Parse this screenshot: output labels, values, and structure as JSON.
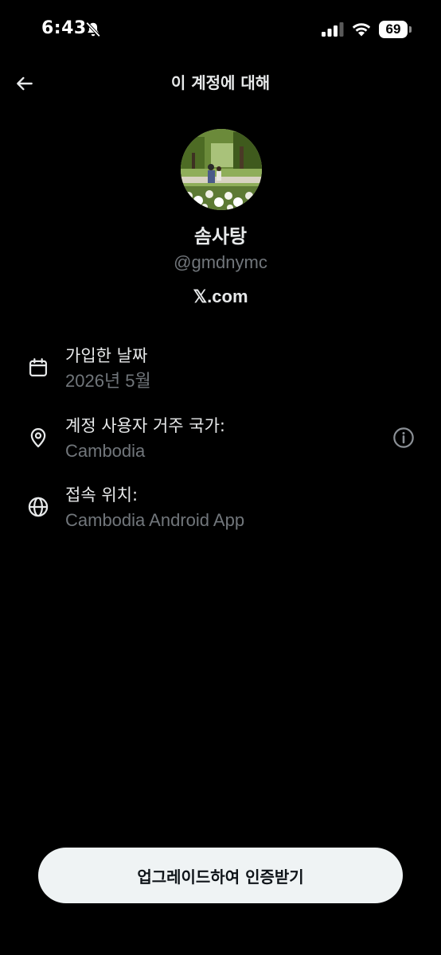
{
  "status_bar": {
    "time": "6:43",
    "battery": "69"
  },
  "header": {
    "title": "이 계정에 대해"
  },
  "profile": {
    "display_name": "솜사탕",
    "handle": "@gmdnymc",
    "site": "𝕏.com"
  },
  "info": {
    "joined": {
      "label": "가입한 날짜",
      "value": "2026년 5월"
    },
    "based_in": {
      "label": "계정 사용자 거주 국가:",
      "value": "Cambodia"
    },
    "connected_via": {
      "label": "접속 위치:",
      "value": "Cambodia Android App"
    }
  },
  "actions": {
    "upgrade_label": "업그레이드하여 인증받기"
  },
  "icons": {
    "back": "arrow-left-icon",
    "bell_off": "bell-slash-icon",
    "signal": "cellular-signal-icon",
    "wifi": "wifi-icon",
    "battery": "battery-icon",
    "calendar": "calendar-icon",
    "location": "location-pin-icon",
    "globe": "globe-icon",
    "info": "info-circle-icon"
  },
  "colors": {
    "background": "#000000",
    "primary_text": "#e7e9ea",
    "secondary_text": "#71767b",
    "button_bg": "#eff3f4",
    "button_text": "#0f1419"
  }
}
